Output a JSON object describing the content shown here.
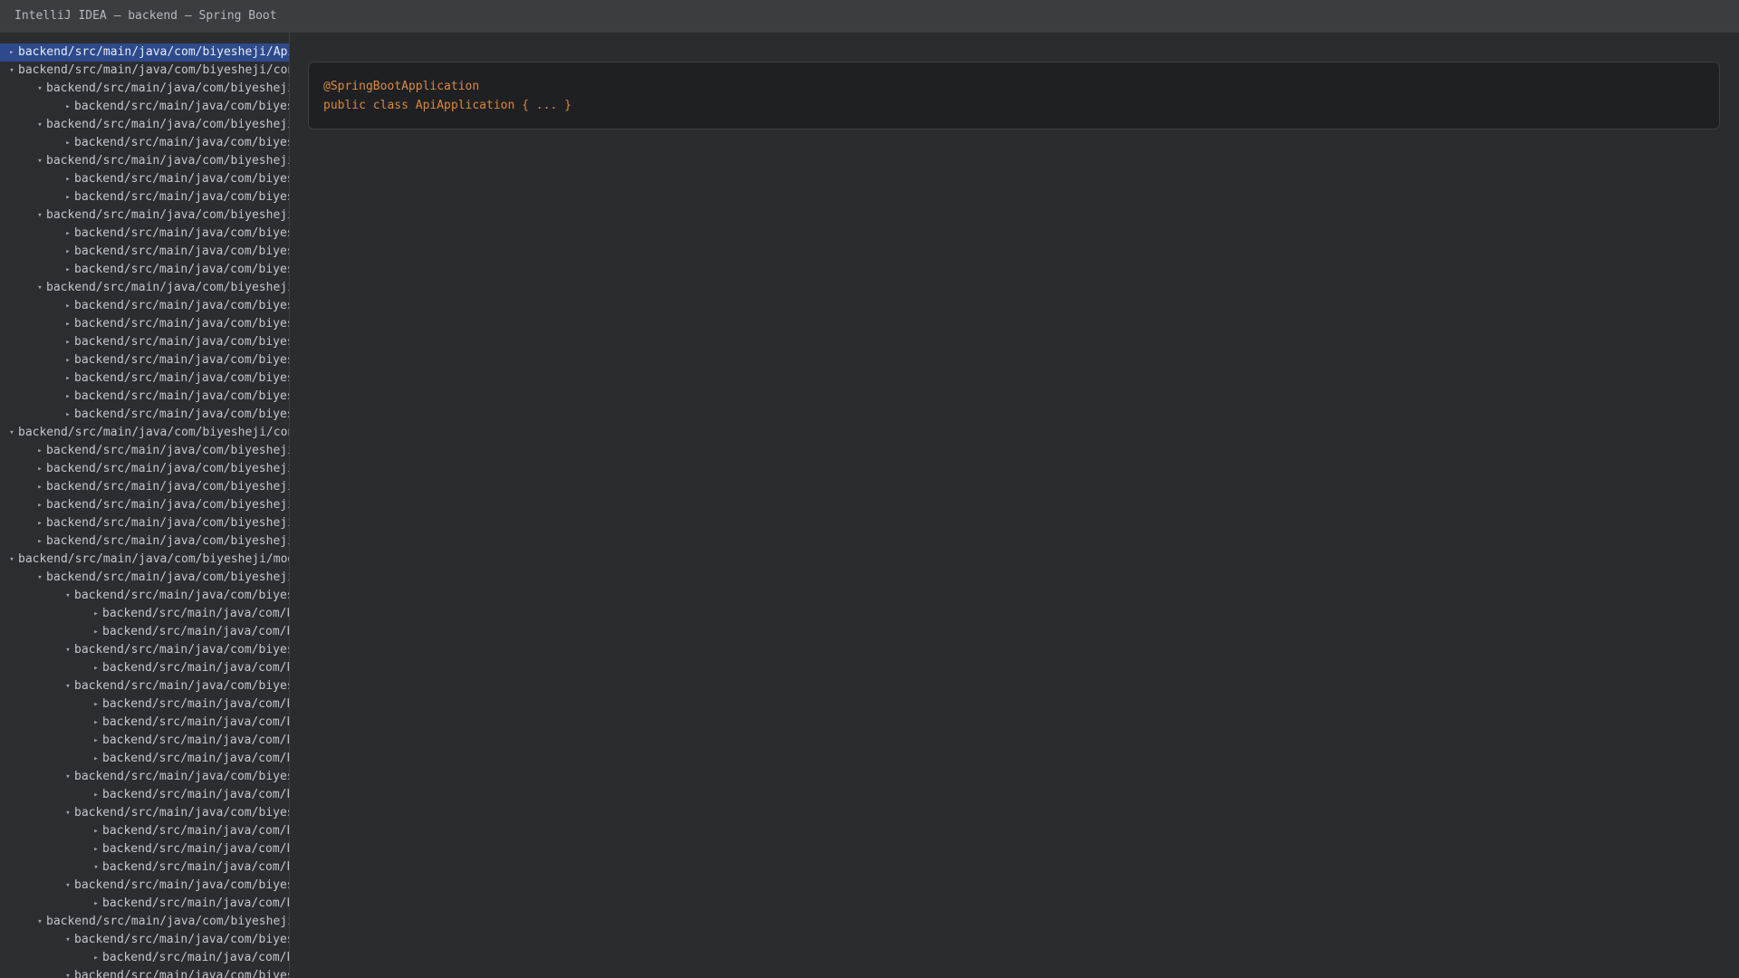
{
  "window": {
    "title": "IntelliJ IDEA — backend — Spring Boot"
  },
  "sidebar": {
    "tree": [
      {
        "level": 0,
        "arrow": "▸",
        "label": "backend/src/main/java/com/biyesheji/ApiApplication.java",
        "selected": true
      },
      {
        "level": 0,
        "arrow": "▾",
        "label": "backend/src/main/java/com/biyesheji/config"
      },
      {
        "level": 1,
        "arrow": "▾",
        "label": "backend/src/main/java/com/biyesheji/config"
      },
      {
        "level": 2,
        "arrow": "▸",
        "label": "backend/src/main/java/com/biyesheji/config"
      },
      {
        "level": 1,
        "arrow": "▾",
        "label": "backend/src/main/java/com/biyesheji/config"
      },
      {
        "level": 2,
        "arrow": "▸",
        "label": "backend/src/main/java/com/biyesheji/config"
      },
      {
        "level": 1,
        "arrow": "▾",
        "label": "backend/src/main/java/com/biyesheji/config"
      },
      {
        "level": 2,
        "arrow": "▸",
        "label": "backend/src/main/java/com/biyesheji/config"
      },
      {
        "level": 2,
        "arrow": "▸",
        "label": "backend/src/main/java/com/biyesheji/config"
      },
      {
        "level": 1,
        "arrow": "▾",
        "label": "backend/src/main/java/com/biyesheji/config"
      },
      {
        "level": 2,
        "arrow": "▸",
        "label": "backend/src/main/java/com/biyesheji/config"
      },
      {
        "level": 2,
        "arrow": "▸",
        "label": "backend/src/main/java/com/biyesheji/config"
      },
      {
        "level": 2,
        "arrow": "▸",
        "label": "backend/src/main/java/com/biyesheji/config"
      },
      {
        "level": 1,
        "arrow": "▾",
        "label": "backend/src/main/java/com/biyesheji/config"
      },
      {
        "level": 2,
        "arrow": "▸",
        "label": "backend/src/main/java/com/biyesheji/config"
      },
      {
        "level": 2,
        "arrow": "▸",
        "label": "backend/src/main/java/com/biyesheji/config"
      },
      {
        "level": 2,
        "arrow": "▸",
        "label": "backend/src/main/java/com/biyesheji/config"
      },
      {
        "level": 2,
        "arrow": "▸",
        "label": "backend/src/main/java/com/biyesheji/config"
      },
      {
        "level": 2,
        "arrow": "▸",
        "label": "backend/src/main/java/com/biyesheji/config"
      },
      {
        "level": 2,
        "arrow": "▸",
        "label": "backend/src/main/java/com/biyesheji/config"
      },
      {
        "level": 2,
        "arrow": "▸",
        "label": "backend/src/main/java/com/biyesheji/config"
      },
      {
        "level": 0,
        "arrow": "▾",
        "label": "backend/src/main/java/com/biyesheji/controller"
      },
      {
        "level": 1,
        "arrow": "▸",
        "label": "backend/src/main/java/com/biyesheji/controller"
      },
      {
        "level": 1,
        "arrow": "▸",
        "label": "backend/src/main/java/com/biyesheji/controller"
      },
      {
        "level": 1,
        "arrow": "▸",
        "label": "backend/src/main/java/com/biyesheji/controller"
      },
      {
        "level": 1,
        "arrow": "▸",
        "label": "backend/src/main/java/com/biyesheji/controller"
      },
      {
        "level": 1,
        "arrow": "▸",
        "label": "backend/src/main/java/com/biyesheji/controller"
      },
      {
        "level": 1,
        "arrow": "▸",
        "label": "backend/src/main/java/com/biyesheji/controller"
      },
      {
        "level": 0,
        "arrow": "▾",
        "label": "backend/src/main/java/com/biyesheji/model"
      },
      {
        "level": 1,
        "arrow": "▾",
        "label": "backend/src/main/java/com/biyesheji/model"
      },
      {
        "level": 2,
        "arrow": "▾",
        "label": "backend/src/main/java/com/biyesheji/model"
      },
      {
        "level": 3,
        "arrow": "▸",
        "label": "backend/src/main/java/com/biyesheji/model"
      },
      {
        "level": 3,
        "arrow": "▸",
        "label": "backend/src/main/java/com/biyesheji/model"
      },
      {
        "level": 2,
        "arrow": "▾",
        "label": "backend/src/main/java/com/biyesheji/model"
      },
      {
        "level": 3,
        "arrow": "▸",
        "label": "backend/src/main/java/com/biyesheji/model"
      },
      {
        "level": 2,
        "arrow": "▾",
        "label": "backend/src/main/java/com/biyesheji/model"
      },
      {
        "level": 3,
        "arrow": "▸",
        "label": "backend/src/main/java/com/biyesheji/model"
      },
      {
        "level": 3,
        "arrow": "▸",
        "label": "backend/src/main/java/com/biyesheji/model"
      },
      {
        "level": 3,
        "arrow": "▸",
        "label": "backend/src/main/java/com/biyesheji/model"
      },
      {
        "level": 3,
        "arrow": "▸",
        "label": "backend/src/main/java/com/biyesheji/model"
      },
      {
        "level": 2,
        "arrow": "▾",
        "label": "backend/src/main/java/com/biyesheji/model"
      },
      {
        "level": 3,
        "arrow": "▸",
        "label": "backend/src/main/java/com/biyesheji/model"
      },
      {
        "level": 2,
        "arrow": "▾",
        "label": "backend/src/main/java/com/biyesheji/model"
      },
      {
        "level": 3,
        "arrow": "▸",
        "label": "backend/src/main/java/com/biyesheji/model"
      },
      {
        "level": 3,
        "arrow": "▸",
        "label": "backend/src/main/java/com/biyesheji/model"
      },
      {
        "level": 3,
        "arrow": "▾",
        "label": "backend/src/main/java/com/biyesheji/model"
      },
      {
        "level": 2,
        "arrow": "▾",
        "label": "backend/src/main/java/com/biyesheji/model"
      },
      {
        "level": 3,
        "arrow": "▸",
        "label": "backend/src/main/java/com/biyesheji/model"
      },
      {
        "level": 1,
        "arrow": "▾",
        "label": "backend/src/main/java/com/biyesheji/model"
      },
      {
        "level": 2,
        "arrow": "▾",
        "label": "backend/src/main/java/com/biyesheji/model"
      },
      {
        "level": 3,
        "arrow": "▸",
        "label": "backend/src/main/java/com/biyesheji/model"
      },
      {
        "level": 2,
        "arrow": "▾",
        "label": "backend/src/main/java/com/biyesheji/model"
      }
    ]
  },
  "editor": {
    "annotation": "@SpringBootApplication",
    "declaration": "public class ApiApplication { ... }"
  }
}
